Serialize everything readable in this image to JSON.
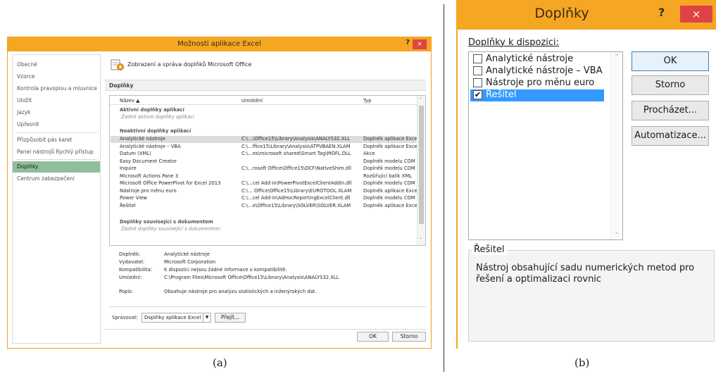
{
  "panel_a": {
    "window_title": "Možnosti aplikace Excel",
    "help_glyph": "?",
    "close_glyph": "×",
    "nav_items": [
      "Obecné",
      "Vzorce",
      "Kontrola pravopisu a mluvnice",
      "Uložit",
      "Jazyk",
      "Upřesnit",
      "Přizpůsobit pás karet",
      "Panel nástrojů Rychlý přístup",
      "Doplňky",
      "Centrum zabezpečení"
    ],
    "active_nav_index": 8,
    "header": "Zobrazení a správa doplňků Microsoft Office",
    "section": "Doplňky",
    "columns": {
      "name": "Název ▲",
      "location": "Umístění",
      "type": "Typ"
    },
    "group_active": "Aktivní doplňky aplikací",
    "group_active_empty": "Žádné aktivní doplňky aplikací",
    "group_inactive": "Neaktivní doplňky aplikací",
    "rows": [
      {
        "name": "Analytické nástroje",
        "location": "C:\\...\\Office15\\Library\\Analysis\\ANALYS32.XLL",
        "type": "Doplněk aplikace Excel"
      },
      {
        "name": "Analytické nástroje – VBA",
        "location": "C:\\...ffice15\\Library\\Analysis\\ATPVBAEN.XLAM",
        "type": "Doplněk aplikace Excel"
      },
      {
        "name": "Datum (XML)",
        "location": "C:\\...es\\microsoft shared\\Smart Tag\\MOFL.DLL",
        "type": "Akce"
      },
      {
        "name": "Easy Document Creator",
        "location": "",
        "type": "Doplněk modelu COM"
      },
      {
        "name": "Inquire",
        "location": "C:\\...rosoft Office\\Office15\\DCF\\NativeShim.dll",
        "type": "Doplněk modelu COM"
      },
      {
        "name": "Microsoft Actions Pane 3",
        "location": "",
        "type": "Rozšiřující balík XML"
      },
      {
        "name": "Microsoft Office PowerPivot for Excel 2013",
        "location": "C:\\...cel Add-in\\PowerPivotExcelClientAddIn.dll",
        "type": "Doplněk modelu COM"
      },
      {
        "name": "Nástroje pro měnu euro",
        "location": "C:\\... Office\\Office15\\Library\\EUROTOOL.XLAM",
        "type": "Doplněk aplikace Excel"
      },
      {
        "name": "Power View",
        "location": "C:\\...cel Add-in\\AdHocReportingExcelClient.dll",
        "type": "Doplněk modelu COM"
      },
      {
        "name": "Řešitel",
        "location": "C:\\...e\\Office15\\Library\\SOLVER\\SOLVER.XLAM",
        "type": "Doplněk aplikace Excel"
      }
    ],
    "selected_row_index": 0,
    "group_doc": "Doplňky související s dokumentem",
    "group_doc_empty": "Žádné doplňky související s dokumentem",
    "details": {
      "addin_label": "Doplněk:",
      "addin_value": "Analytické nástroje",
      "publisher_label": "Vydavatel:",
      "publisher_value": "Microsoft Corporation",
      "compat_label": "Kompatibilita:",
      "compat_value": "K dispozici nejsou žádné informace o kompatibilitě.",
      "location_label": "Umístění:",
      "location_value": "C:\\Program Files\\Microsoft Office\\Office15\\Library\\Analysis\\ANALYS32.XLL",
      "desc_label": "Popis:",
      "desc_value": "Obsahuje nástroje pro analýzu statistických a inženýrských dat."
    },
    "manage_label": "Spravovat:",
    "manage_value": "Doplňky aplikace Excel",
    "go_button": "Přejít...",
    "ok_button": "OK",
    "cancel_button": "Storno",
    "caption": "(a)"
  },
  "panel_b": {
    "window_title": "Doplňky",
    "help_glyph": "?",
    "close_glyph": "×",
    "list_label": "Doplňky k dispozici:",
    "items": [
      {
        "label": "Analytické nástroje",
        "checked": false
      },
      {
        "label": "Analytické nástroje – VBA",
        "checked": false
      },
      {
        "label": "Nástroje pro měnu euro",
        "checked": false
      },
      {
        "label": "Řešitel",
        "checked": true
      }
    ],
    "selected_item_index": 3,
    "check_glyph": "✔",
    "buttons": {
      "ok": "OK",
      "cancel": "Storno",
      "browse": "Procházet...",
      "automation": "Automatizace..."
    },
    "description_title": "Řešitel",
    "description_line1": "Nástroj obsahující sadu numerických metod pro",
    "description_line2": "řešení a optimalizaci rovnic",
    "caption": "(b)"
  }
}
